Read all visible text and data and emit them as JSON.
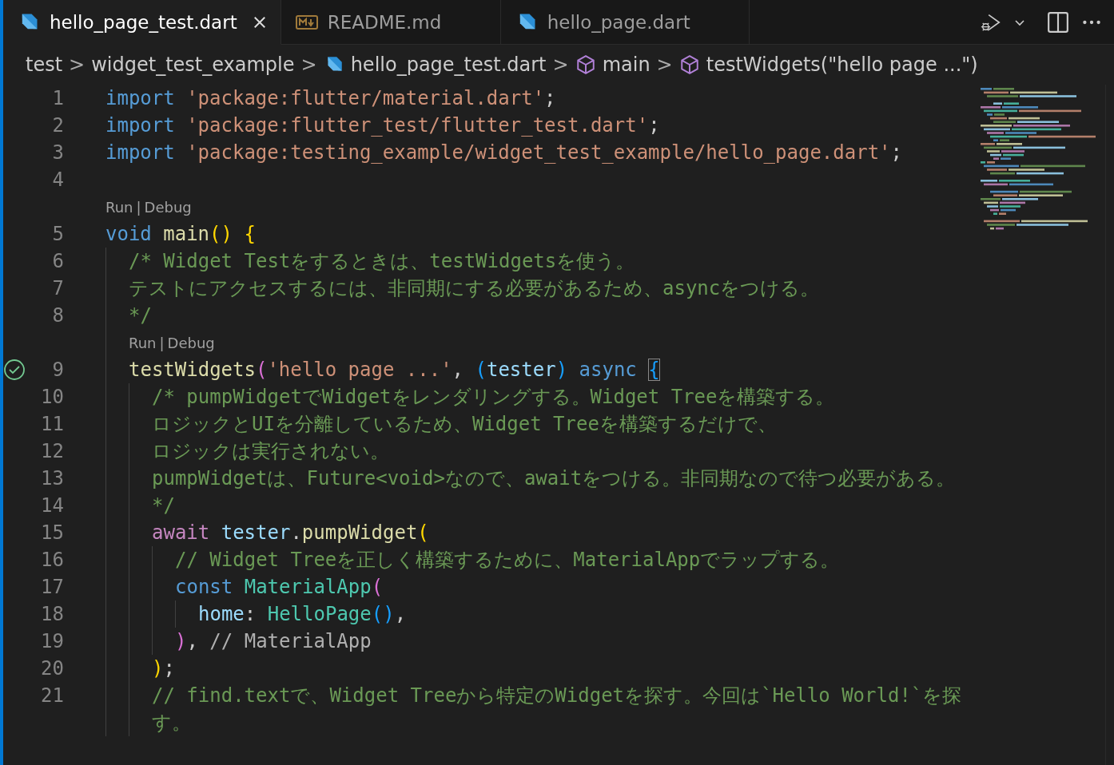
{
  "tabs": [
    {
      "label": "hello_page_test.dart",
      "kind": "dart",
      "selected": true
    },
    {
      "label": "README.md",
      "kind": "markdown",
      "selected": false
    },
    {
      "label": "hello_page.dart",
      "kind": "dart",
      "selected": false
    }
  ],
  "breadcrumb": [
    {
      "label": "test",
      "kind": "folder"
    },
    {
      "label": "widget_test_example",
      "kind": "folder"
    },
    {
      "label": "hello_page_test.dart",
      "kind": "dart"
    },
    {
      "label": "main",
      "kind": "symbol"
    },
    {
      "label": "testWidgets(\"hello page ...\")",
      "kind": "symbol"
    }
  ],
  "breadcrumb_separator": ">",
  "lines": [
    {
      "kind": "code",
      "number": "1",
      "tokens": [
        {
          "t": "import",
          "kind": "kw"
        },
        {
          "t": " 'package:flutter/material.dart'",
          "kind": "str"
        },
        {
          "t": ";",
          "kind": "p"
        }
      ]
    },
    {
      "kind": "code",
      "number": "2",
      "tokens": [
        {
          "t": "import",
          "kind": "kw"
        },
        {
          "t": " 'package:flutter_test/flutter_test.dart'",
          "kind": "str"
        },
        {
          "t": ";",
          "kind": "p"
        }
      ]
    },
    {
      "kind": "code",
      "number": "3",
      "tokens": [
        {
          "t": "import",
          "kind": "kw"
        },
        {
          "t": " 'package:testing_example/widget_test_example/hello_page.dart'",
          "kind": "str"
        },
        {
          "t": ";",
          "kind": "p"
        }
      ]
    },
    {
      "kind": "code",
      "number": "4"
    },
    {
      "kind": "codelens",
      "links": [
        "Run",
        "Debug"
      ],
      "separator": "|"
    },
    {
      "kind": "code",
      "number": "5",
      "tokens": [
        {
          "t": "void",
          "kind": "kw"
        },
        {
          "t": " main",
          "kind": "fn"
        },
        {
          "t": "()",
          "kind": "b1"
        },
        {
          "t": " {",
          "kind": "b1"
        }
      ],
      "children": [
        {
          "kind": "code",
          "number": "6",
          "tokens": [
            {
              "t": "/* Widget Testをするときは、testWidgetsを使う。",
              "kind": "cmt"
            }
          ]
        },
        {
          "kind": "code",
          "number": "7",
          "tokens": [
            {
              "t": "テストにアクセスするには、非同期にする必要があるため、asyncをつける。",
              "kind": "cmt"
            }
          ]
        },
        {
          "kind": "code",
          "number": "8",
          "tokens": [
            {
              "t": "*/",
              "kind": "cmt"
            }
          ]
        },
        {
          "kind": "codelens",
          "links": [
            "Run",
            "Debug"
          ],
          "separator": "|"
        },
        {
          "kind": "code",
          "number": "9",
          "passed": true,
          "tokens": [
            {
              "t": "testWidgets",
              "kind": "fn"
            },
            {
              "t": "(",
              "kind": "b2"
            },
            {
              "t": "'hello page ...'",
              "kind": "str"
            },
            {
              "t": ",",
              "kind": "p"
            },
            {
              "t": " (",
              "kind": "b3"
            },
            {
              "t": "tester",
              "kind": "var"
            },
            {
              "t": ")",
              "kind": "b3"
            },
            {
              "t": " async ",
              "kind": "kw"
            },
            {
              "t": "{",
              "kind": "b3",
              "matched": true
            }
          ],
          "children": [
            {
              "kind": "code",
              "number": "10",
              "tokens": [
                {
                  "t": "/* pumpWidgetでWidgetをレンダリングする。Widget Treeを構築する。",
                  "kind": "cmt"
                }
              ]
            },
            {
              "kind": "code",
              "number": "11",
              "tokens": [
                {
                  "t": "ロジックとUIを分離しているため、Widget Treeを構築するだけで、",
                  "kind": "cmt"
                }
              ]
            },
            {
              "kind": "code",
              "number": "12",
              "tokens": [
                {
                  "t": "ロジックは実行されない。",
                  "kind": "cmt"
                }
              ]
            },
            {
              "kind": "code",
              "number": "13",
              "tokens": [
                {
                  "t": "pumpWidgetは、Future<void>なので、awaitをつける。非同期なので待つ必要がある。",
                  "kind": "cmt"
                }
              ]
            },
            {
              "kind": "code",
              "number": "14",
              "tokens": [
                {
                  "t": "*/",
                  "kind": "cmt"
                }
              ]
            },
            {
              "kind": "code",
              "number": "15",
              "tokens": [
                {
                  "t": "await",
                  "kind": "ctrl"
                },
                {
                  "t": " tester",
                  "kind": "var"
                },
                {
                  "t": ".",
                  "kind": "p"
                },
                {
                  "t": "pumpWidget",
                  "kind": "fn"
                },
                {
                  "t": "(",
                  "kind": "b1"
                }
              ],
              "children": [
                {
                  "kind": "code",
                  "number": "16",
                  "tokens": [
                    {
                      "t": "// Widget Treeを正しく構築するために、MaterialAppでラップする。",
                      "kind": "cmt"
                    }
                  ]
                },
                {
                  "kind": "code",
                  "number": "17",
                  "tokens": [
                    {
                      "t": "const",
                      "kind": "kw"
                    },
                    {
                      "t": " MaterialApp",
                      "kind": "cls"
                    },
                    {
                      "t": "(",
                      "kind": "b2"
                    }
                  ],
                  "children": [
                    {
                      "kind": "code",
                      "number": "18",
                      "tokens": [
                        {
                          "t": "home",
                          "kind": "var"
                        },
                        {
                          "t": ":",
                          "kind": "p"
                        },
                        {
                          "t": " HelloPage",
                          "kind": "cls"
                        },
                        {
                          "t": "()",
                          "kind": "b3"
                        },
                        {
                          "t": ",",
                          "kind": "p"
                        }
                      ]
                    }
                  ]
                },
                {
                  "kind": "code",
                  "number": "19",
                  "tokens": [
                    {
                      "t": ")",
                      "kind": "b2"
                    },
                    {
                      "t": ",",
                      "kind": "p"
                    },
                    {
                      "t": " // MaterialApp",
                      "kind": "label"
                    }
                  ]
                }
              ]
            },
            {
              "kind": "code",
              "number": "20",
              "tokens": [
                {
                  "t": ")",
                  "kind": "b1"
                },
                {
                  "t": ";",
                  "kind": "p"
                }
              ]
            },
            {
              "kind": "code",
              "number": "21",
              "tokens": [
                {
                  "t": "// find.textで、Widget Treeから特定のWidgetを探す。今回は`Hello World!`を探",
                  "kind": "cmt"
                }
              ],
              "continuation": "す。"
            }
          ]
        }
      ]
    }
  ]
}
